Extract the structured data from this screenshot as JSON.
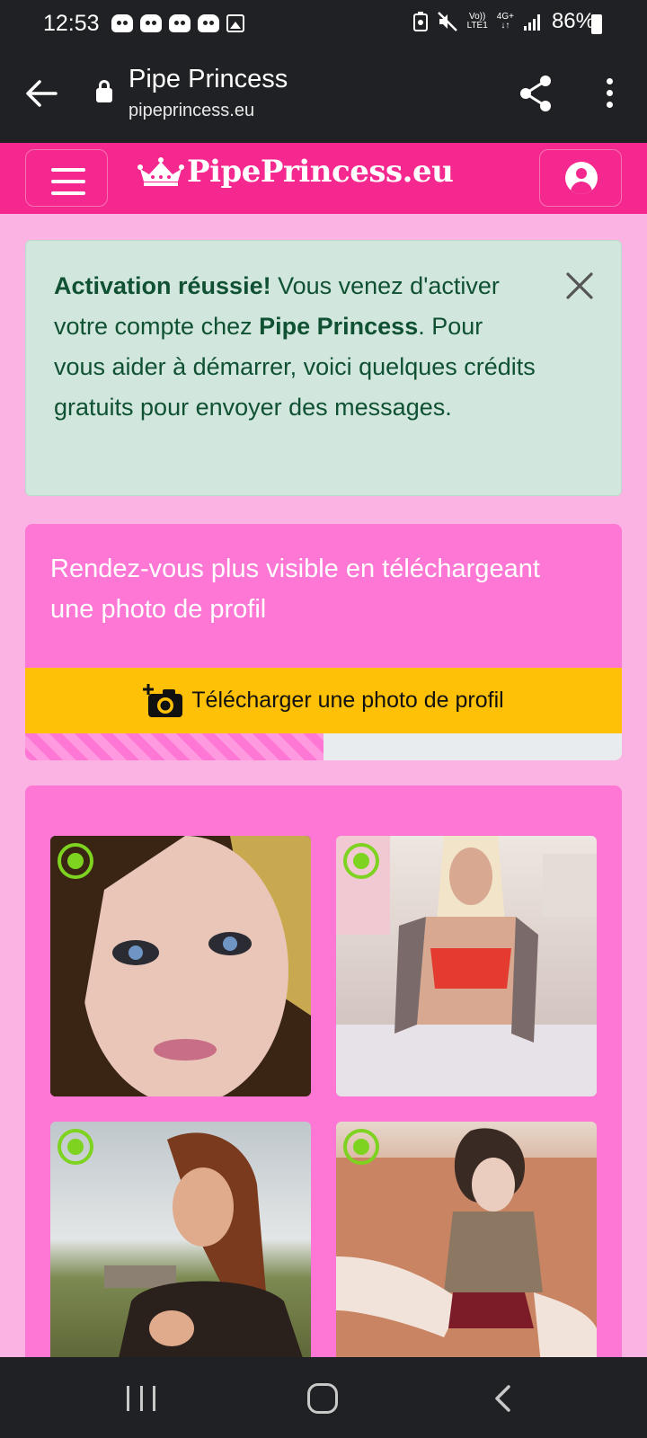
{
  "status_bar": {
    "time": "12:53",
    "network_top": "Vo))",
    "network_bottom": "LTE1",
    "data_top": "4G+",
    "data_bottom": "↓↑",
    "battery": "86%"
  },
  "browser": {
    "title": "Pipe Princess",
    "url": "pipeprincess.eu"
  },
  "header": {
    "logo_text": "PipePrincess.eu"
  },
  "alert": {
    "strong": "Activation réussie!",
    "text1": " Vous venez d'activer votre compte chez ",
    "brand": "Pipe Princess",
    "text2": ". Pour vous aider à démarrer, voici quelques crédits gratuits pour envoyer des messages."
  },
  "upload": {
    "message": "Rendez-vous plus visible en téléchargeant une photo de profil",
    "button_label": "Télécharger une photo de profil",
    "progress_percent": 50
  },
  "colors": {
    "brand_pink": "#f4288e",
    "card_pink": "#ff77d5",
    "page_pink": "#fbb3e3",
    "button_yellow": "#ffc107",
    "online_green": "#7ed321"
  },
  "profiles": [
    {
      "online": true
    },
    {
      "online": true
    },
    {
      "online": true
    },
    {
      "online": true
    }
  ]
}
